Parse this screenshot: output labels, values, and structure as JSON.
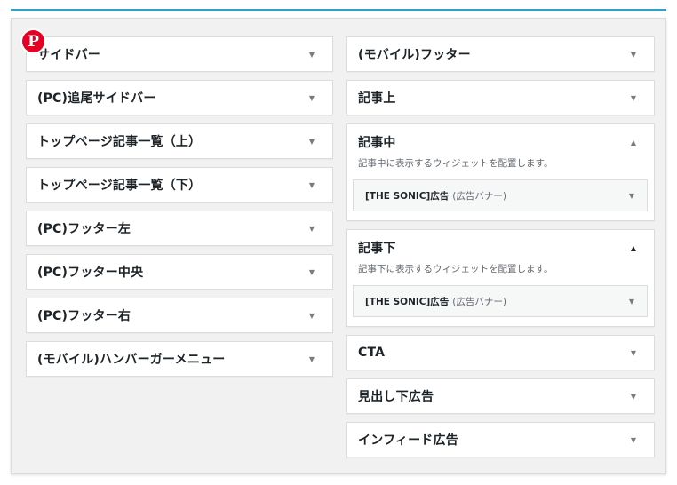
{
  "left_areas": [
    {
      "title": "サイドバー"
    },
    {
      "title": "(PC)追尾サイドバー"
    },
    {
      "title": "トップページ記事一覧（上）"
    },
    {
      "title": "トップページ記事一覧（下）"
    },
    {
      "title": "(PC)フッター左"
    },
    {
      "title": "(PC)フッター中央"
    },
    {
      "title": "(PC)フッター右"
    },
    {
      "title": "(モバイル)ハンバーガーメニュー"
    }
  ],
  "right_areas": [
    {
      "title": "(モバイル)フッター"
    },
    {
      "title": "記事上"
    },
    {
      "title": "記事中",
      "description": "記事中に表示するウィジェットを配置します。",
      "widget": {
        "title": "[THE SONIC]広告",
        "subtitle": "(広告バナー)"
      }
    },
    {
      "title": "記事下",
      "description": "記事下に表示するウィジェットを配置します。",
      "widget": {
        "title": "[THE SONIC]広告",
        "subtitle": "(広告バナー)"
      }
    },
    {
      "title": "CTA"
    },
    {
      "title": "見出し下広告"
    },
    {
      "title": "インフィード広告"
    }
  ],
  "icons": {
    "arrow_down": "▼",
    "arrow_up": "▲",
    "pinterest": "P"
  },
  "colors": {
    "accent_line": "#2ea2cc",
    "pinterest": "#e60023"
  }
}
